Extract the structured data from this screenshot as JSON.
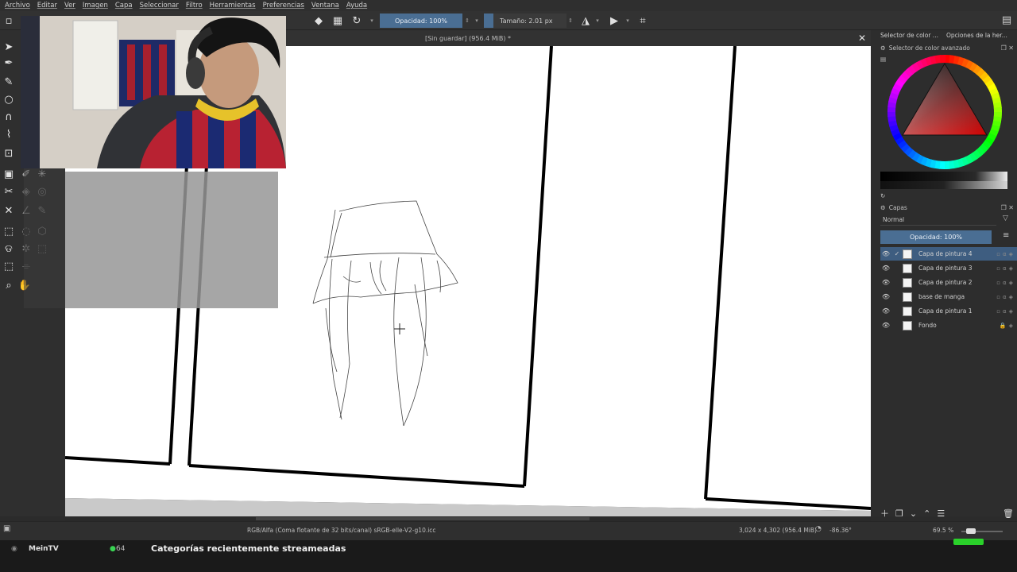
{
  "menubar": {
    "items": [
      "Archivo",
      "Editar",
      "Ver",
      "Imagen",
      "Capa",
      "Seleccionar",
      "Filtro",
      "Herramientas",
      "Preferencias",
      "Ventana",
      "Ayuda"
    ]
  },
  "toolbar": {
    "opacity_label": "Opacidad: 100%",
    "size_label": "Tamaño: 2.01 px"
  },
  "document": {
    "title": "[Sin guardar]  (956.4 MiB) *"
  },
  "right_panel": {
    "tabs": [
      "Selector de color ...",
      "Opciones de la her..."
    ],
    "color_selector_title": "Selector de color avanzado",
    "layers_title": "Capas",
    "blend_mode": "Normal",
    "opacity_label": "Opacidad:  100%",
    "layers": [
      {
        "name": "Capa de pintura 4",
        "active": true,
        "locked": false
      },
      {
        "name": "Capa de pintura 3",
        "active": false,
        "locked": false
      },
      {
        "name": "Capa de pintura 2",
        "active": false,
        "locked": false
      },
      {
        "name": "base de manga",
        "active": false,
        "locked": false
      },
      {
        "name": "Capa de pintura 1",
        "active": false,
        "locked": false
      },
      {
        "name": "Fondo",
        "active": false,
        "locked": true
      }
    ]
  },
  "status": {
    "color_space": "RGB/Alfa (Coma flotante de 32 bits/canal)  sRGB-elle-V2-g10.icc",
    "dimensions": "3,024 x 4,302 (956.4 MiB)",
    "rotation": "-86.36°",
    "zoom": "69.5 %"
  },
  "stream": {
    "channel": "MeinTV",
    "viewers": "64",
    "section_title": "Categorías recientemente streameadas"
  },
  "colors": {
    "accent": "#4a6e93",
    "active_layer": "#3e5d80",
    "live_green": "#2ad12a"
  }
}
